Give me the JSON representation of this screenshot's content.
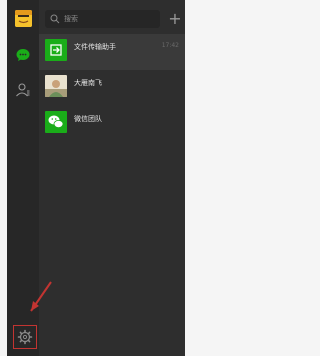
{
  "search": {
    "placeholder": "搜索"
  },
  "toolbar": {
    "add_label": "+"
  },
  "chats": [
    {
      "name": "文件传输助手",
      "time": "17:42",
      "icon": "file-transfer-icon"
    },
    {
      "name": "大雁南飞",
      "time": "",
      "icon": "user-avatar"
    },
    {
      "name": "微信团队",
      "time": "",
      "icon": "wechat-icon"
    }
  ],
  "colors": {
    "accent": "#1aad19",
    "sidebar": "#272727",
    "list_panel": "#2e2e2e",
    "highlight": "#c23431"
  }
}
